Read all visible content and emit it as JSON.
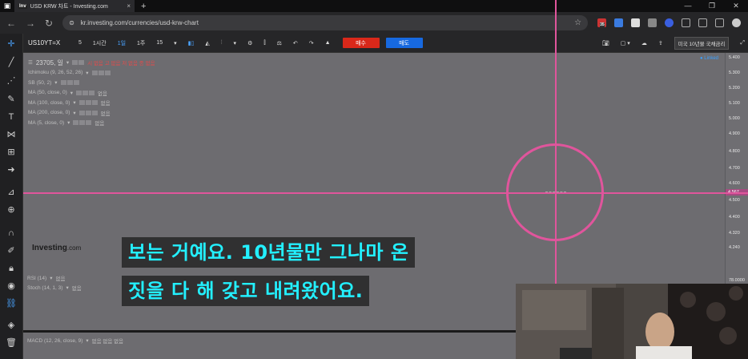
{
  "browser": {
    "tab_title": "USD KRW 차트 - Investing.com",
    "favicon_text": "Inv",
    "url": "kr.investing.com/currencies/usd-krw-chart",
    "new_tab": "+",
    "ext_badge": "35"
  },
  "toolbar": {
    "symbol": "US10YT=X",
    "interval_min": "5",
    "interval_hour": "1시간",
    "interval_day": "1일",
    "interval_week": "1주",
    "interval_count": "15",
    "buy_label": "매수",
    "sell_label": "매도",
    "instrument_tag": "미국 10년물 국채금리"
  },
  "chart": {
    "legend_title": "23705, 일",
    "legend_title_tail": "시 없음  고 없음  저 없음  종 없음",
    "legend_rows": [
      {
        "label": "Ichimoku (9, 26, 52, 26)",
        "value": ""
      },
      {
        "label": "SB (50, 2)",
        "value": ""
      },
      {
        "label": "MA (50, close, 0)",
        "value": "없음"
      },
      {
        "label": "MA (100, close, 0)",
        "value": "없음"
      },
      {
        "label": "MA (200, close, 0)",
        "value": "없음"
      },
      {
        "label": "MA (5, close, 0)",
        "value": "없음"
      }
    ],
    "logo_main": "Investing",
    "logo_sub": ".com",
    "link_label": "● Linked"
  },
  "price_axis": {
    "ticks": [
      "5.400",
      "5.300",
      "5.200",
      "5.100",
      "5.000",
      "4.900",
      "4.800",
      "4.700",
      "4.600",
      "4.500",
      "4.400",
      "4.320",
      "4.240"
    ],
    "marker": "4.567",
    "lower_tick": "78.0000"
  },
  "panes": [
    {
      "label": "RSI (14)",
      "value": "없음"
    },
    {
      "label": "Stoch (14, 1, 3)",
      "value": "없음"
    },
    {
      "label": "MACD (12, 26, close, 9)",
      "value": "없음  없음  없음"
    }
  ],
  "subtitles": [
    "보는 거예요. 10년물만 그나마 온",
    "짓을 다 해 갖고 내려왔어요."
  ],
  "colors": {
    "crosshair": "#e0559c",
    "subtitle_text": "#23f0ff",
    "buy": "#d9281a",
    "sell": "#1769e0"
  }
}
